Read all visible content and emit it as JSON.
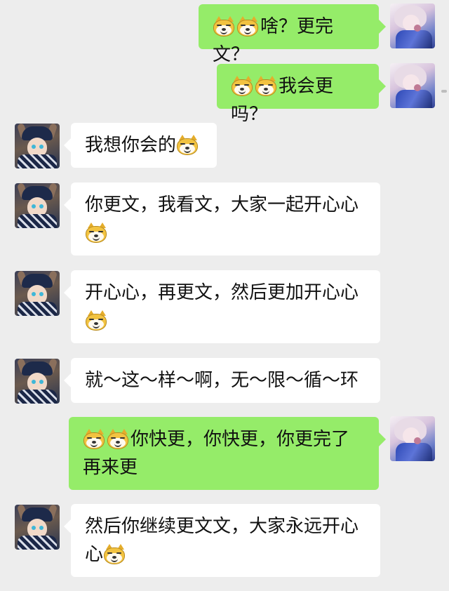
{
  "emoji": {
    "doge": "doge-emoji"
  },
  "colors": {
    "background": "#ededed",
    "sent_bubble": "#95ec69",
    "received_bubble": "#ffffff"
  },
  "messages": [
    {
      "side": "right",
      "text": "啥？更完文？"
    },
    {
      "side": "right",
      "text": "我会更吗？"
    },
    {
      "side": "left",
      "text": "我想你会的"
    },
    {
      "side": "left",
      "line1": "你更文，我看文，大家一起开心心"
    },
    {
      "side": "left",
      "line1": "开心心，再更文，然后更加开心心"
    },
    {
      "side": "left",
      "text": "就～这～样～啊，无～限～循～环"
    },
    {
      "side": "right",
      "line1": "你快更，你快更，你更完了",
      "line2": "再来更"
    },
    {
      "side": "left",
      "line1": "然后你继续更文文，大家永远开心",
      "line2": "心"
    }
  ]
}
